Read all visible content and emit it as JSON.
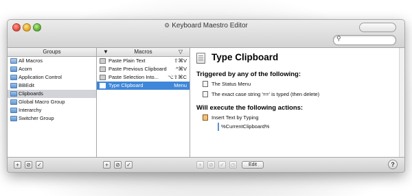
{
  "window": {
    "title": "Keyboard Maestro Editor",
    "title_icon": "keyboard-maestro-icon"
  },
  "search": {
    "placeholder": "",
    "value": ""
  },
  "groups": {
    "header": "Groups",
    "items": [
      {
        "label": "All Macros",
        "icon": "smart-folder-icon"
      },
      {
        "label": "Acorn",
        "icon": "folder-icon"
      },
      {
        "label": "Application Control",
        "icon": "folder-icon"
      },
      {
        "label": "BBEdit",
        "icon": "folder-icon"
      },
      {
        "label": "Clipboards",
        "icon": "folder-icon",
        "selected": true
      },
      {
        "label": "Global Macro Group",
        "icon": "folder-icon"
      },
      {
        "label": "Interarchy",
        "icon": "folder-icon"
      },
      {
        "label": "Switcher Group",
        "icon": "folder-icon"
      }
    ]
  },
  "macros": {
    "header": "Macros",
    "sort_left": "▼",
    "sort_right": "▽",
    "items": [
      {
        "label": "Paste Plain Text",
        "hotkey": "⇧⌘V"
      },
      {
        "label": "Paste Previous Clipboard",
        "hotkey": "^⌘V"
      },
      {
        "label": "Paste Selection Into...",
        "hotkey": "⌥⇧⌘C"
      },
      {
        "label": "Type Clipboard",
        "hotkey": "Menu",
        "selected": true
      }
    ]
  },
  "editor": {
    "macro_title": "Type Clipboard",
    "triggers_heading": "Triggered by any of the following:",
    "triggers": [
      {
        "label": "The Status Menu",
        "icon": "menu-trigger-icon"
      },
      {
        "label": "The exact case string '==' is typed (then delete)",
        "icon": "typed-string-trigger-icon"
      }
    ],
    "actions_heading": "Will execute the following actions:",
    "actions": [
      {
        "label": "Insert Text by Typing",
        "icon": "insert-text-action-icon",
        "value": "%CurrentClipboard%"
      }
    ]
  },
  "bottombar": {
    "groups_buttons": [
      "+",
      "⊘",
      "✓"
    ],
    "macros_buttons": [
      "+",
      "⊘",
      "✓"
    ],
    "editor_buttons": [
      "+",
      "⊘",
      "✓",
      "◷"
    ],
    "edit_label": "Edit",
    "help_label": "?"
  },
  "colors": {
    "selection_blue": "#3f87d8",
    "group_selection_gray": "#d2d4d9",
    "window_chrome": "#e4e4e4"
  }
}
